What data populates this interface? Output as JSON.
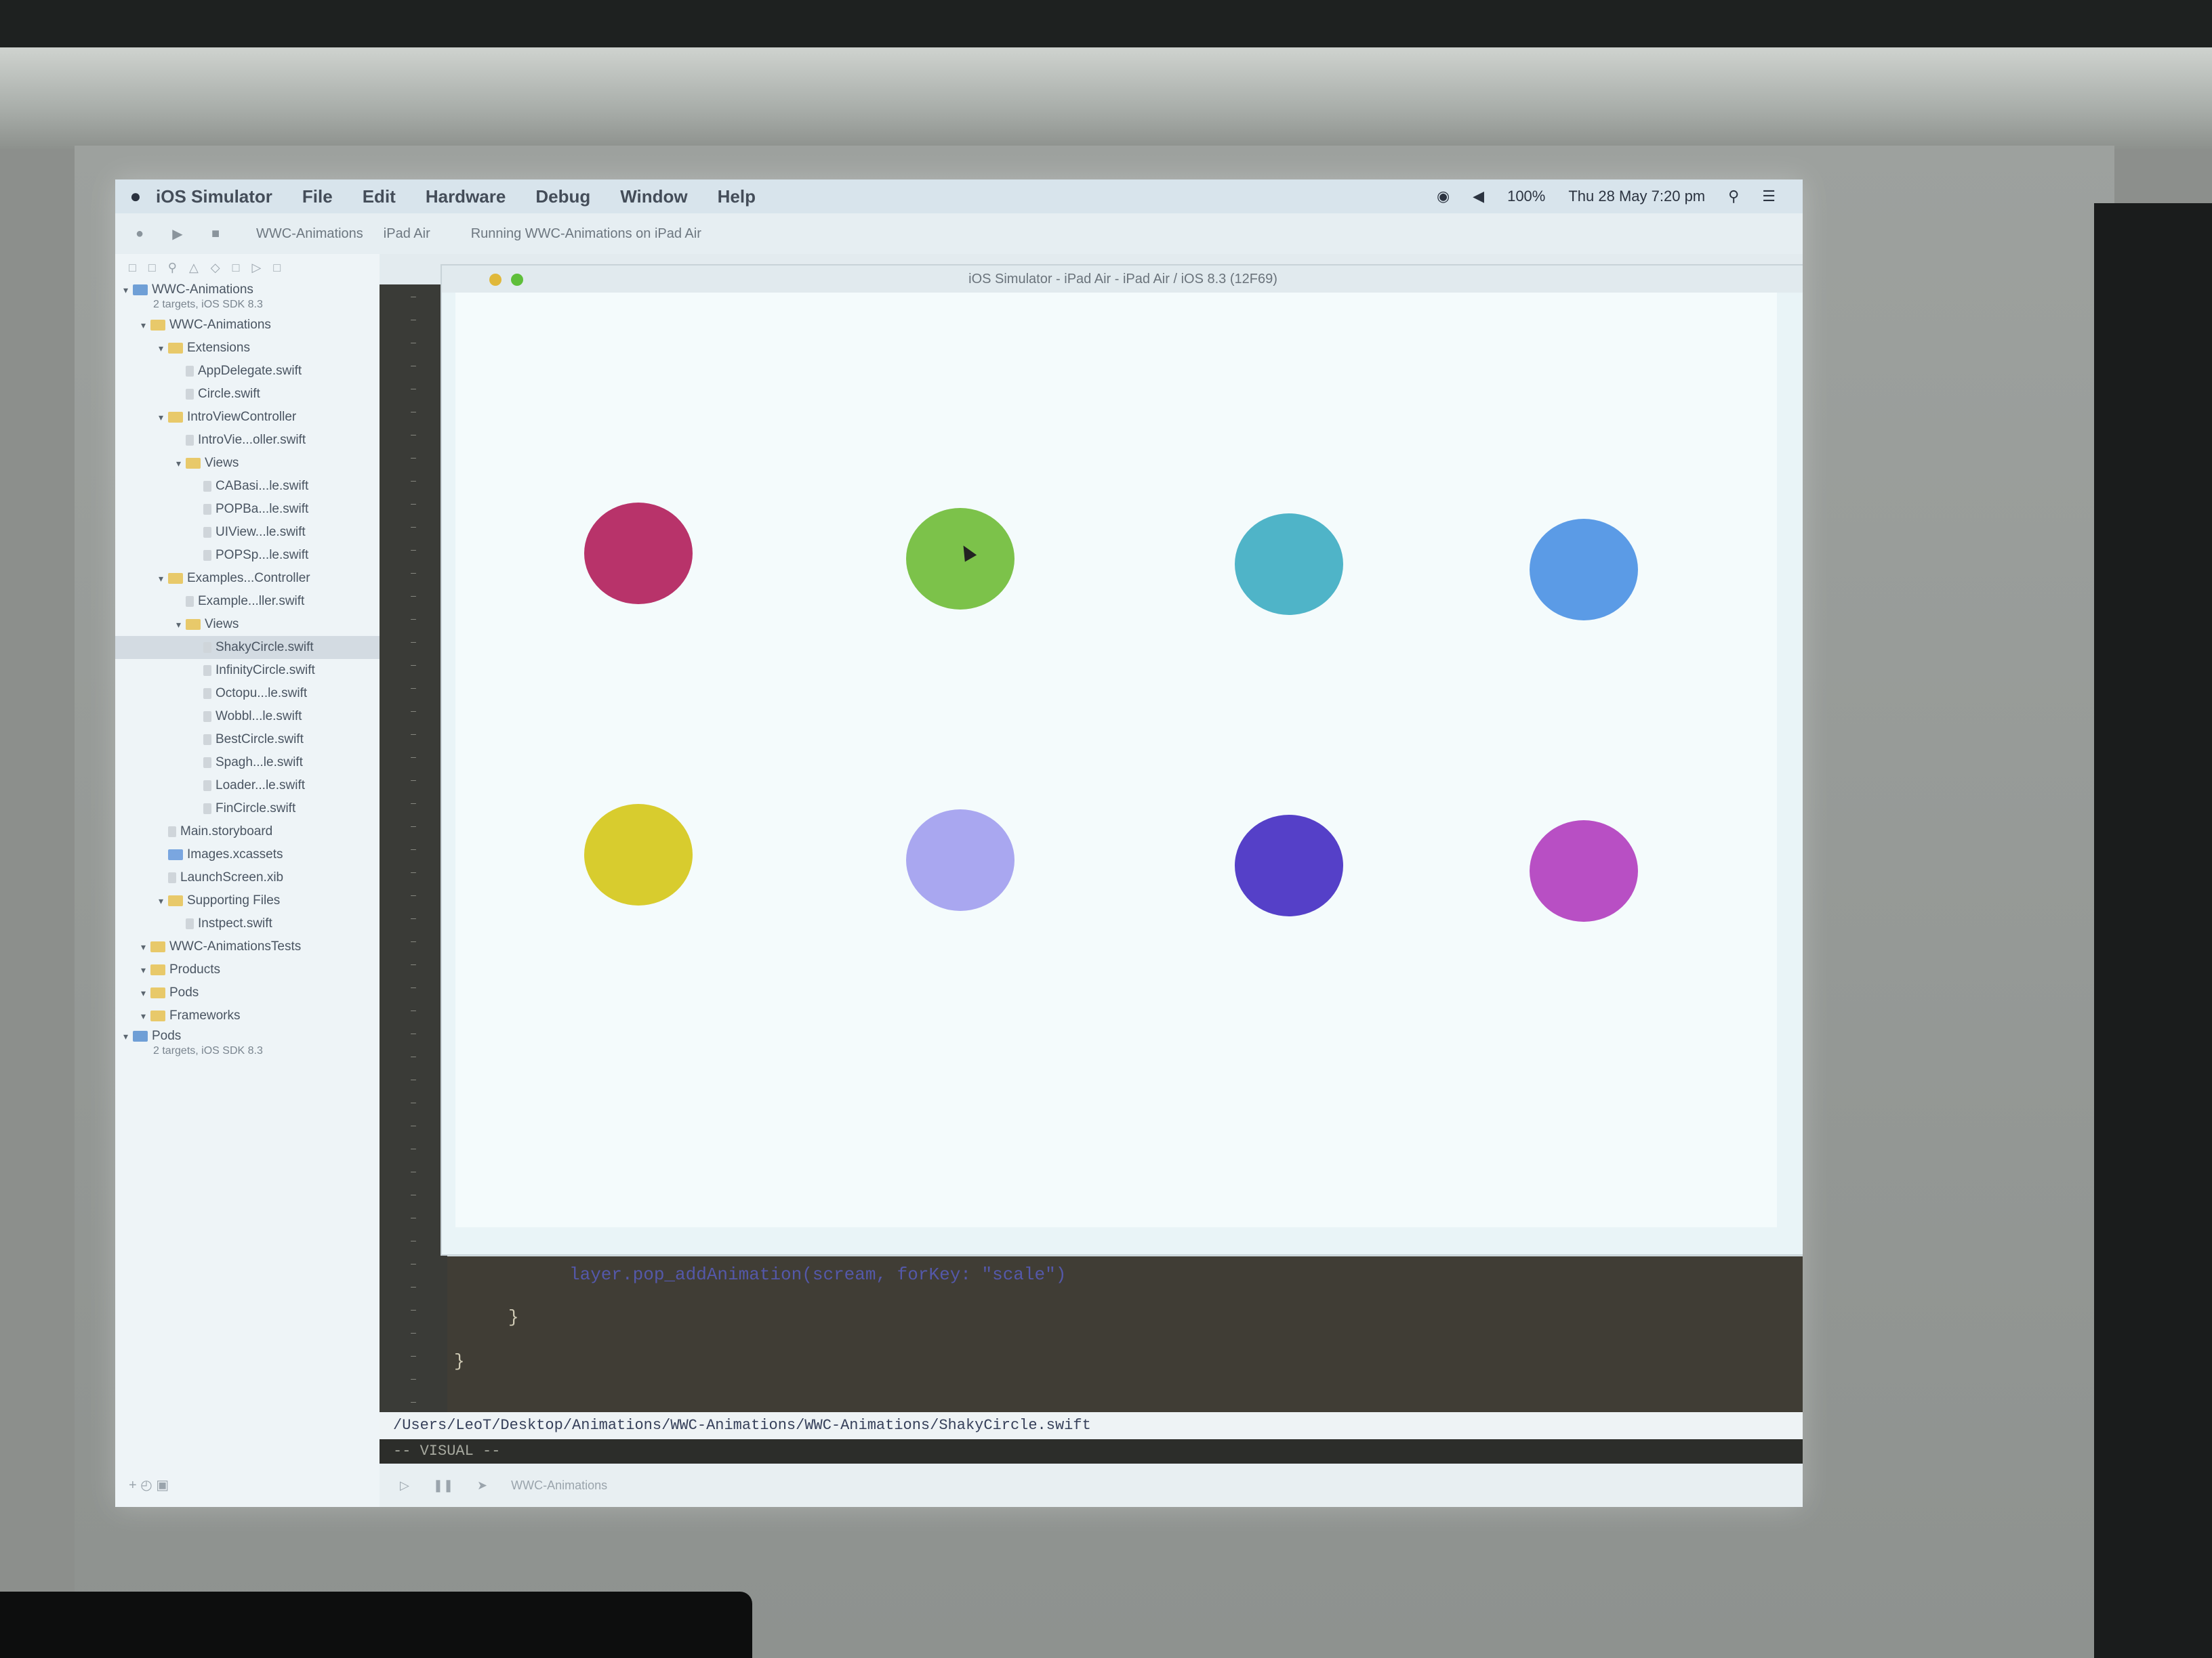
{
  "menubar": {
    "app": "iOS Simulator",
    "items": [
      "File",
      "Edit",
      "Hardware",
      "Debug",
      "Window",
      "Help"
    ],
    "battery": "100%",
    "clock": "Thu 28 May  7:20 pm"
  },
  "toolbar": {
    "scheme": "WWC-Animations",
    "device": "iPad Air",
    "status": "Running WWC-Animations on iPad Air"
  },
  "simulator": {
    "title": "iOS Simulator - iPad Air - iPad Air / iOS 8.3 (12F69)"
  },
  "navigator": {
    "items": [
      {
        "label": "WWC-Animations",
        "sub": "2 targets, iOS SDK 8.3",
        "indent": 0,
        "icon": "project"
      },
      {
        "label": "WWC-Animations",
        "indent": 1,
        "icon": "folder"
      },
      {
        "label": "Extensions",
        "indent": 2,
        "icon": "folder"
      },
      {
        "label": "AppDelegate.swift",
        "indent": 3,
        "icon": "swift"
      },
      {
        "label": "Circle.swift",
        "indent": 3,
        "icon": "swift"
      },
      {
        "label": "IntroViewController",
        "indent": 2,
        "icon": "folder"
      },
      {
        "label": "IntroVie...oller.swift",
        "indent": 3,
        "icon": "swift"
      },
      {
        "label": "Views",
        "indent": 3,
        "icon": "folder"
      },
      {
        "label": "CABasi...le.swift",
        "indent": 4,
        "icon": "swift"
      },
      {
        "label": "POPBa...le.swift",
        "indent": 4,
        "icon": "swift"
      },
      {
        "label": "UIView...le.swift",
        "indent": 4,
        "icon": "swift"
      },
      {
        "label": "POPSp...le.swift",
        "indent": 4,
        "icon": "swift"
      },
      {
        "label": "Examples...Controller",
        "indent": 2,
        "icon": "folder"
      },
      {
        "label": "Example...ller.swift",
        "indent": 3,
        "icon": "swift"
      },
      {
        "label": "Views",
        "indent": 3,
        "icon": "folder"
      },
      {
        "label": "ShakyCircle.swift",
        "indent": 4,
        "icon": "swift",
        "selected": true
      },
      {
        "label": "InfinityCircle.swift",
        "indent": 4,
        "icon": "swift"
      },
      {
        "label": "Octopu...le.swift",
        "indent": 4,
        "icon": "swift"
      },
      {
        "label": "Wobbl...le.swift",
        "indent": 4,
        "icon": "swift"
      },
      {
        "label": "BestCircle.swift",
        "indent": 4,
        "icon": "swift"
      },
      {
        "label": "Spagh...le.swift",
        "indent": 4,
        "icon": "swift"
      },
      {
        "label": "Loader...le.swift",
        "indent": 4,
        "icon": "swift"
      },
      {
        "label": "FinCircle.swift",
        "indent": 4,
        "icon": "swift"
      },
      {
        "label": "Main.storyboard",
        "indent": 2,
        "icon": "swift"
      },
      {
        "label": "Images.xcassets",
        "indent": 2,
        "icon": "assets"
      },
      {
        "label": "LaunchScreen.xib",
        "indent": 2,
        "icon": "swift"
      },
      {
        "label": "Supporting Files",
        "indent": 2,
        "icon": "folder"
      },
      {
        "label": "Instpect.swift",
        "indent": 3,
        "icon": "swift"
      },
      {
        "label": "WWC-AnimationsTests",
        "indent": 1,
        "icon": "folder"
      },
      {
        "label": "Products",
        "indent": 1,
        "icon": "folder"
      },
      {
        "label": "Pods",
        "indent": 1,
        "icon": "folder"
      },
      {
        "label": "Frameworks",
        "indent": 1,
        "icon": "folder"
      },
      {
        "label": "Pods",
        "sub": "2 targets, iOS SDK 8.3",
        "indent": 0,
        "icon": "project"
      }
    ]
  },
  "circles": [
    {
      "name": "circle-crimson",
      "color": "#b8336a"
    },
    {
      "name": "circle-green",
      "color": "#7cc24a"
    },
    {
      "name": "circle-teal",
      "color": "#4fb4c8"
    },
    {
      "name": "circle-blue",
      "color": "#5b9be6"
    },
    {
      "name": "circle-yellow",
      "color": "#d8cc2e"
    },
    {
      "name": "circle-lavender",
      "color": "#a9a7f0"
    },
    {
      "name": "circle-indigo",
      "color": "#5540c8"
    },
    {
      "name": "circle-magenta",
      "color": "#b84fc4"
    }
  ],
  "code": {
    "line1": "layer.pop_addAnimation(scream, forKey: \"scale\")",
    "line2": "}",
    "line3": "}"
  },
  "pathbar": "/Users/LeoT/Desktop/Animations/WWC-Animations/WWC-Animations/ShakyCircle.swift",
  "modebar": "-- VISUAL --",
  "debugbar": "WWC-Animations"
}
